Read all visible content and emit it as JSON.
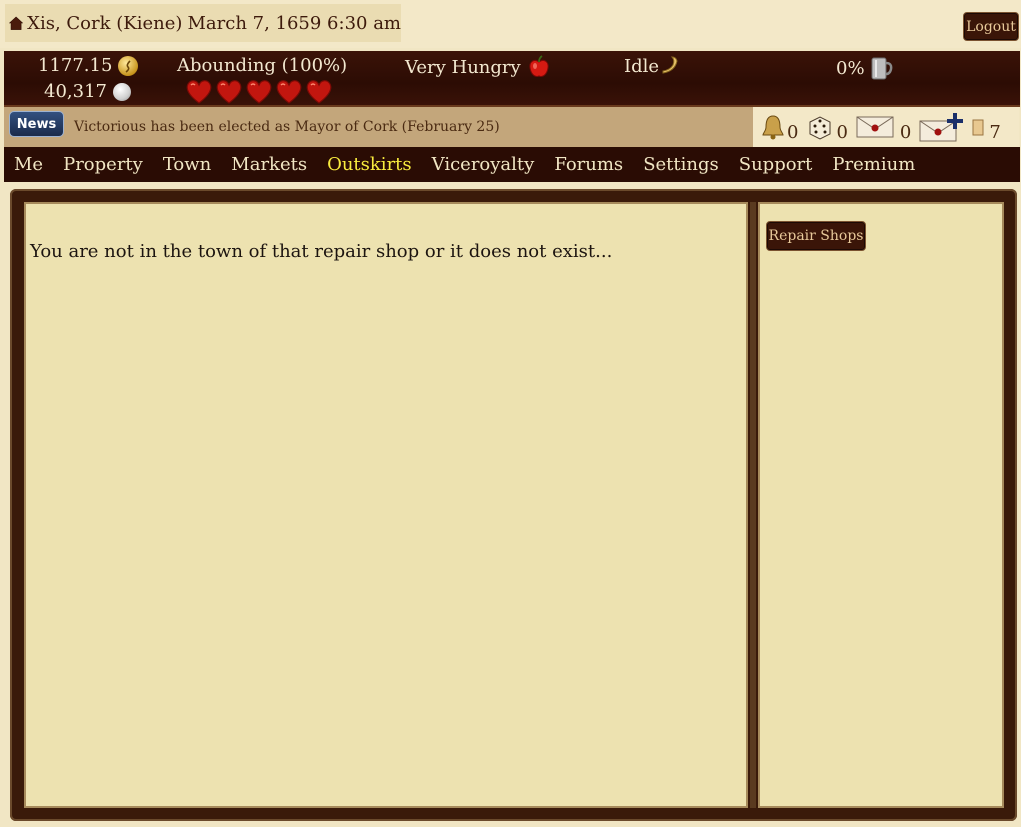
{
  "header": {
    "location": "Xis, Cork (Kiene)",
    "datetime": "March 7, 1659 6:30 am",
    "logout_label": "Logout"
  },
  "stats": {
    "gold": "1177.15",
    "silver": "40,317",
    "health_label": "Abounding (100%)",
    "hearts_filled": 5,
    "hunger": "Very Hungry",
    "activity": "Idle",
    "drink": "0%"
  },
  "news": {
    "button_label": "News",
    "text": "Victorious has been elected as Mayor of Cork (February 25)"
  },
  "notifications": {
    "bell_count": "0",
    "dice_count": "0",
    "mail_count": "0",
    "scroll_count": "7"
  },
  "nav": {
    "items": [
      "Me",
      "Property",
      "Town",
      "Markets",
      "Outskirts",
      "Viceroyalty",
      "Forums",
      "Settings",
      "Support",
      "Premium"
    ],
    "active": "Outskirts"
  },
  "main": {
    "message": "You are not in the town of that repair shop or it does not exist..."
  },
  "sidebar": {
    "repair_shops_label": "Repair Shops"
  },
  "colors": {
    "nav_active": "#f9ec3e",
    "nav_bg": "#2a0c04",
    "panel_bg": "#ede2b0"
  }
}
